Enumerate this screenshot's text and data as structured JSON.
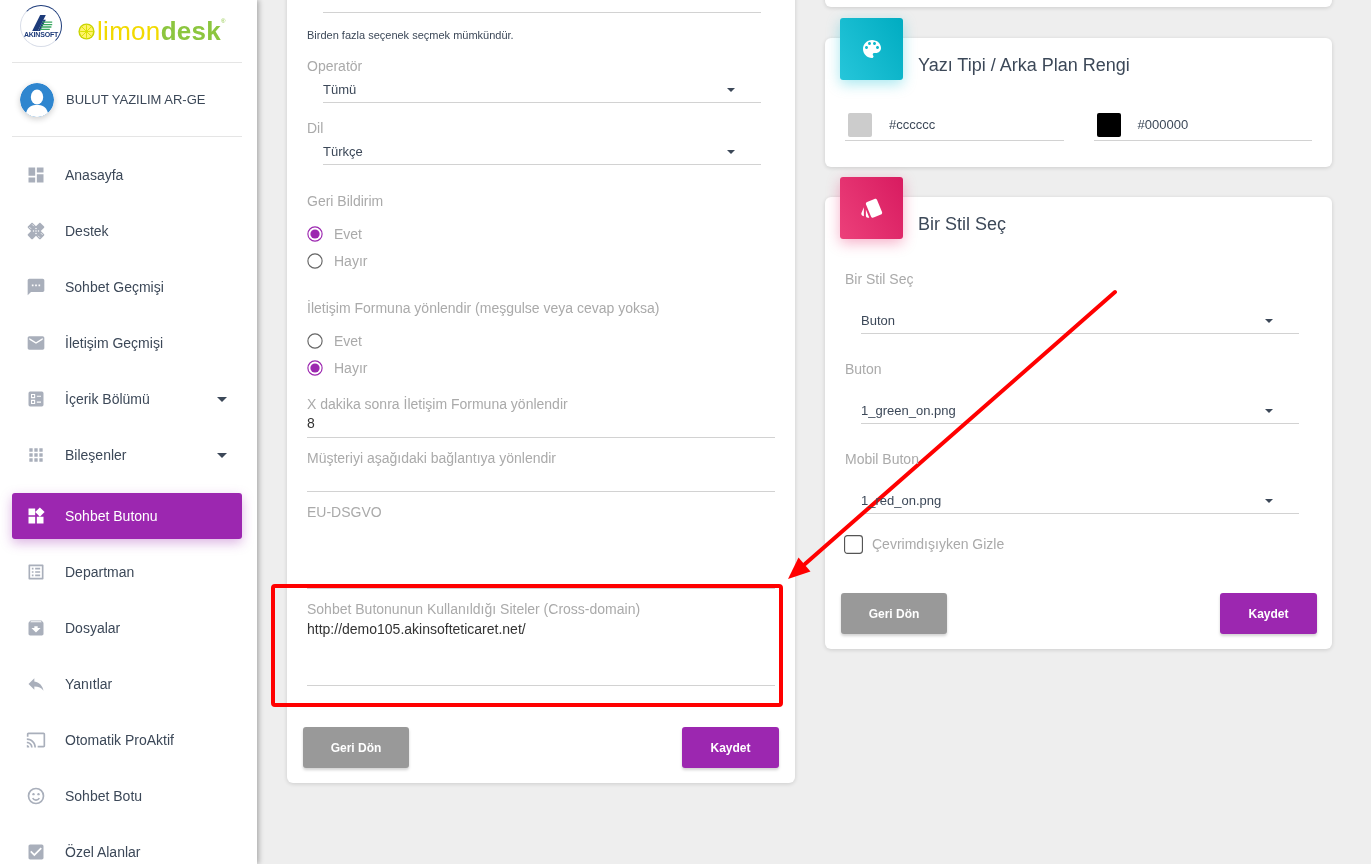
{
  "sidebar": {
    "logo": {
      "emblem_text": "AKINSOFT",
      "wordmark": "limon**desk**$^{®}$"
    },
    "user": {
      "name": "BULUT YAZILIM AR-GE"
    },
    "menu": [
      {
        "label": "Anasayfa",
        "kind": "link",
        "selected": false
      },
      {
        "label": "Destek",
        "kind": "link",
        "selected": false
      },
      {
        "label": "Sohbet Geçmişi",
        "kind": "link",
        "selected": false
      },
      {
        "label": "İletişim Geçmişi",
        "kind": "link",
        "selected": false
      },
      {
        "label": "İçerik Bölümü",
        "kind": "submenu",
        "selected": false
      },
      {
        "label": "Bileşenler",
        "kind": "submenu",
        "selected": false
      },
      {
        "label": "Sohbet Butonu",
        "kind": "link",
        "selected": true
      },
      {
        "label": "Departman",
        "kind": "link",
        "selected": false
      },
      {
        "label": "Dosyalar",
        "kind": "link",
        "selected": false
      },
      {
        "label": "Yanıtlar",
        "kind": "link",
        "selected": false
      },
      {
        "label": "Otomatik ProAktif",
        "kind": "link",
        "selected": false
      },
      {
        "label": "Sohbet Botu",
        "kind": "link",
        "selected": false
      },
      {
        "label": "Özel Alanlar",
        "kind": "link",
        "selected": false
      }
    ]
  },
  "form_card": {
    "fields": [
      {
        "kind": "select",
        "highlighted": false
      },
      {
        "kind": "note",
        "text": "Birden fazla seçenek seçmek mümkündür.",
        "highlighted": false
      },
      {
        "kind": "select",
        "label": "Operatör",
        "value": "Tümü",
        "highlighted": false
      },
      {
        "kind": "select",
        "label": "Dil",
        "value": "Türkçe",
        "highlighted": false
      },
      {
        "kind": "radio",
        "label": "Geri Bildirim",
        "options": [
          {
            "label": "Evet",
            "selected": true
          },
          {
            "label": "Hayır",
            "selected": false
          }
        ],
        "highlighted": false
      },
      {
        "kind": "radio",
        "label": "İletişim Formuna yönlendir (meşgulse veya cevap yoksa)",
        "options": [
          {
            "label": "Evet",
            "selected": false
          },
          {
            "label": "Hayır",
            "selected": true
          }
        ],
        "highlighted": false
      },
      {
        "kind": "input",
        "label": "X dakika sonra İletişim Formuna yönlendir",
        "value": "8",
        "highlighted": false
      },
      {
        "kind": "input",
        "label": "Müşteriyi aşağıdaki bağlantıya yönlendir",
        "highlighted": false
      },
      {
        "kind": "textarea",
        "label": "EU-DSGVO",
        "highlighted": false
      },
      {
        "kind": "textarea",
        "label": "Sohbet Butonunun Kullanıldığı Siteler (Cross-domain)",
        "value": "http://demo105.akinsofteticaret.net/",
        "highlighted": true
      }
    ],
    "buttons": [
      {
        "label": "Geri Dön",
        "kind": "secondary"
      },
      {
        "label": "Kaydet",
        "kind": "primary"
      }
    ]
  },
  "color_card": {
    "title": "Yazı Tipi / Arka Plan Rengi",
    "colors": [
      {
        "value": "#cccccc",
        "color": "#cccccc"
      },
      {
        "value": "#000000",
        "color": "#000000"
      }
    ]
  },
  "style_card": {
    "title": "Bir Stil Seç",
    "fields": [
      {
        "kind": "select",
        "label": "Bir Stil Seç",
        "value": "Buton"
      },
      {
        "kind": "select",
        "label": "Buton",
        "value": "1_green_on.png"
      },
      {
        "kind": "select",
        "label": "Mobil Buton",
        "value": "1_red_on.png"
      },
      {
        "kind": "checkbox",
        "label": "Çevrimdışıyken Gizle",
        "checked": false
      }
    ],
    "buttons": [
      {
        "label": "Geri Dön",
        "kind": "secondary"
      },
      {
        "label": "Kaydet",
        "kind": "primary"
      }
    ]
  },
  "annotation_arrow": true
}
